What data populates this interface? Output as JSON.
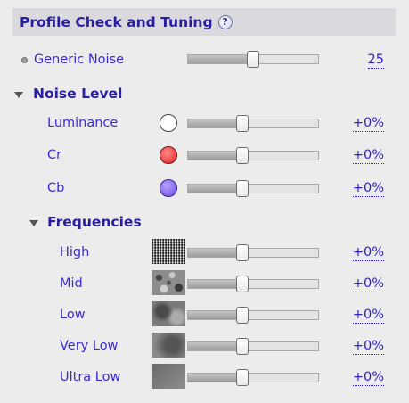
{
  "header": {
    "title": "Profile Check and Tuning",
    "help_icon": "?"
  },
  "generic_noise": {
    "label": "Generic Noise",
    "value": "25",
    "position": 0.5
  },
  "noise_level": {
    "label": "Noise Level",
    "items": [
      {
        "label": "Luminance",
        "value": "+0%",
        "swatch": "white",
        "position": 0.5
      },
      {
        "label": "Cr",
        "value": "+0%",
        "swatch": "#e42525",
        "position": 0.5
      },
      {
        "label": "Cb",
        "value": "+0%",
        "swatch": "#7a55ea",
        "position": 0.5
      }
    ]
  },
  "frequencies": {
    "label": "Frequencies",
    "items": [
      {
        "label": "High",
        "value": "+0%",
        "texture": "high-noise-texture",
        "position": 0.5
      },
      {
        "label": "Mid",
        "value": "+0%",
        "texture": "mid-noise-texture",
        "position": 0.5
      },
      {
        "label": "Low",
        "value": "+0%",
        "texture": "low-noise-texture",
        "position": 0.5
      },
      {
        "label": "Very Low",
        "value": "+0%",
        "texture": "very-low-noise-texture",
        "position": 0.5
      },
      {
        "label": "Ultra Low",
        "value": "+0%",
        "texture": "ultra-low-noise-texture",
        "position": 0.5
      }
    ]
  },
  "colors": {
    "accent_text": "#3a2ad8",
    "header_text": "#2a1da0",
    "header_bg": "#d9d9de"
  }
}
